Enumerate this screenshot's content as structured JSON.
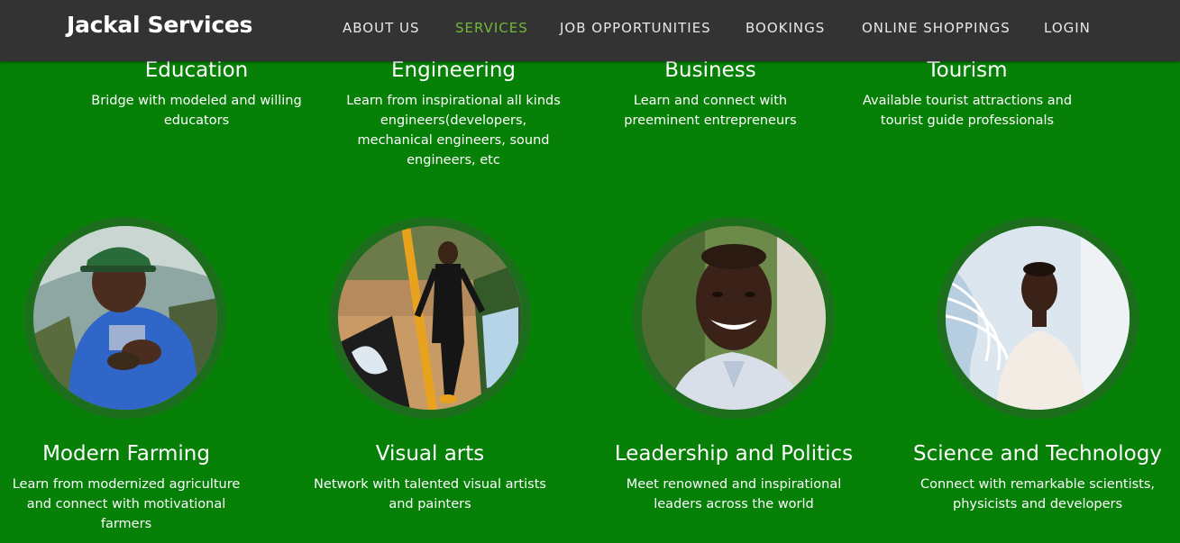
{
  "header": {
    "brand": "Jackal Services",
    "nav": [
      {
        "label": "ABOUT US"
      },
      {
        "label": "SERVICES",
        "active": true
      },
      {
        "label": "JOB OPPORTUNITIES"
      },
      {
        "label": "BOOKINGS"
      },
      {
        "label": "ONLINE SHOPPINGS"
      },
      {
        "label": "LOGIN"
      }
    ],
    "active_color": "#6fb93a"
  },
  "page": {
    "background_color": "#078007"
  },
  "services_top": [
    {
      "title": "Education",
      "description": "Bridge with modeled and willing educators"
    },
    {
      "title": "Engineering",
      "description": "Learn from inspirational all kinds engineers(developers, mechanical engineers, sound engineers, etc"
    },
    {
      "title": "Business",
      "description": "Learn and connect with preeminent entrepreneurs"
    },
    {
      "title": "Tourism",
      "description": "Available tourist attractions and tourist guide professionals"
    }
  ],
  "services_bottom": [
    {
      "title": "Modern Farming",
      "description": "Learn from modernized agriculture and connect with motivational farmers",
      "image": "farmer-photo"
    },
    {
      "title": "Visual arts",
      "description": "Network with talented visual artists and painters",
      "image": "artist-photo"
    },
    {
      "title": "Leadership and Politics",
      "description": "Meet renowned and inspirational leaders across the world",
      "image": "leader-photo"
    },
    {
      "title": "Science and Technology",
      "description": "Connect with remarkable scientists, physicists and developers",
      "image": "scientist-photo"
    }
  ]
}
